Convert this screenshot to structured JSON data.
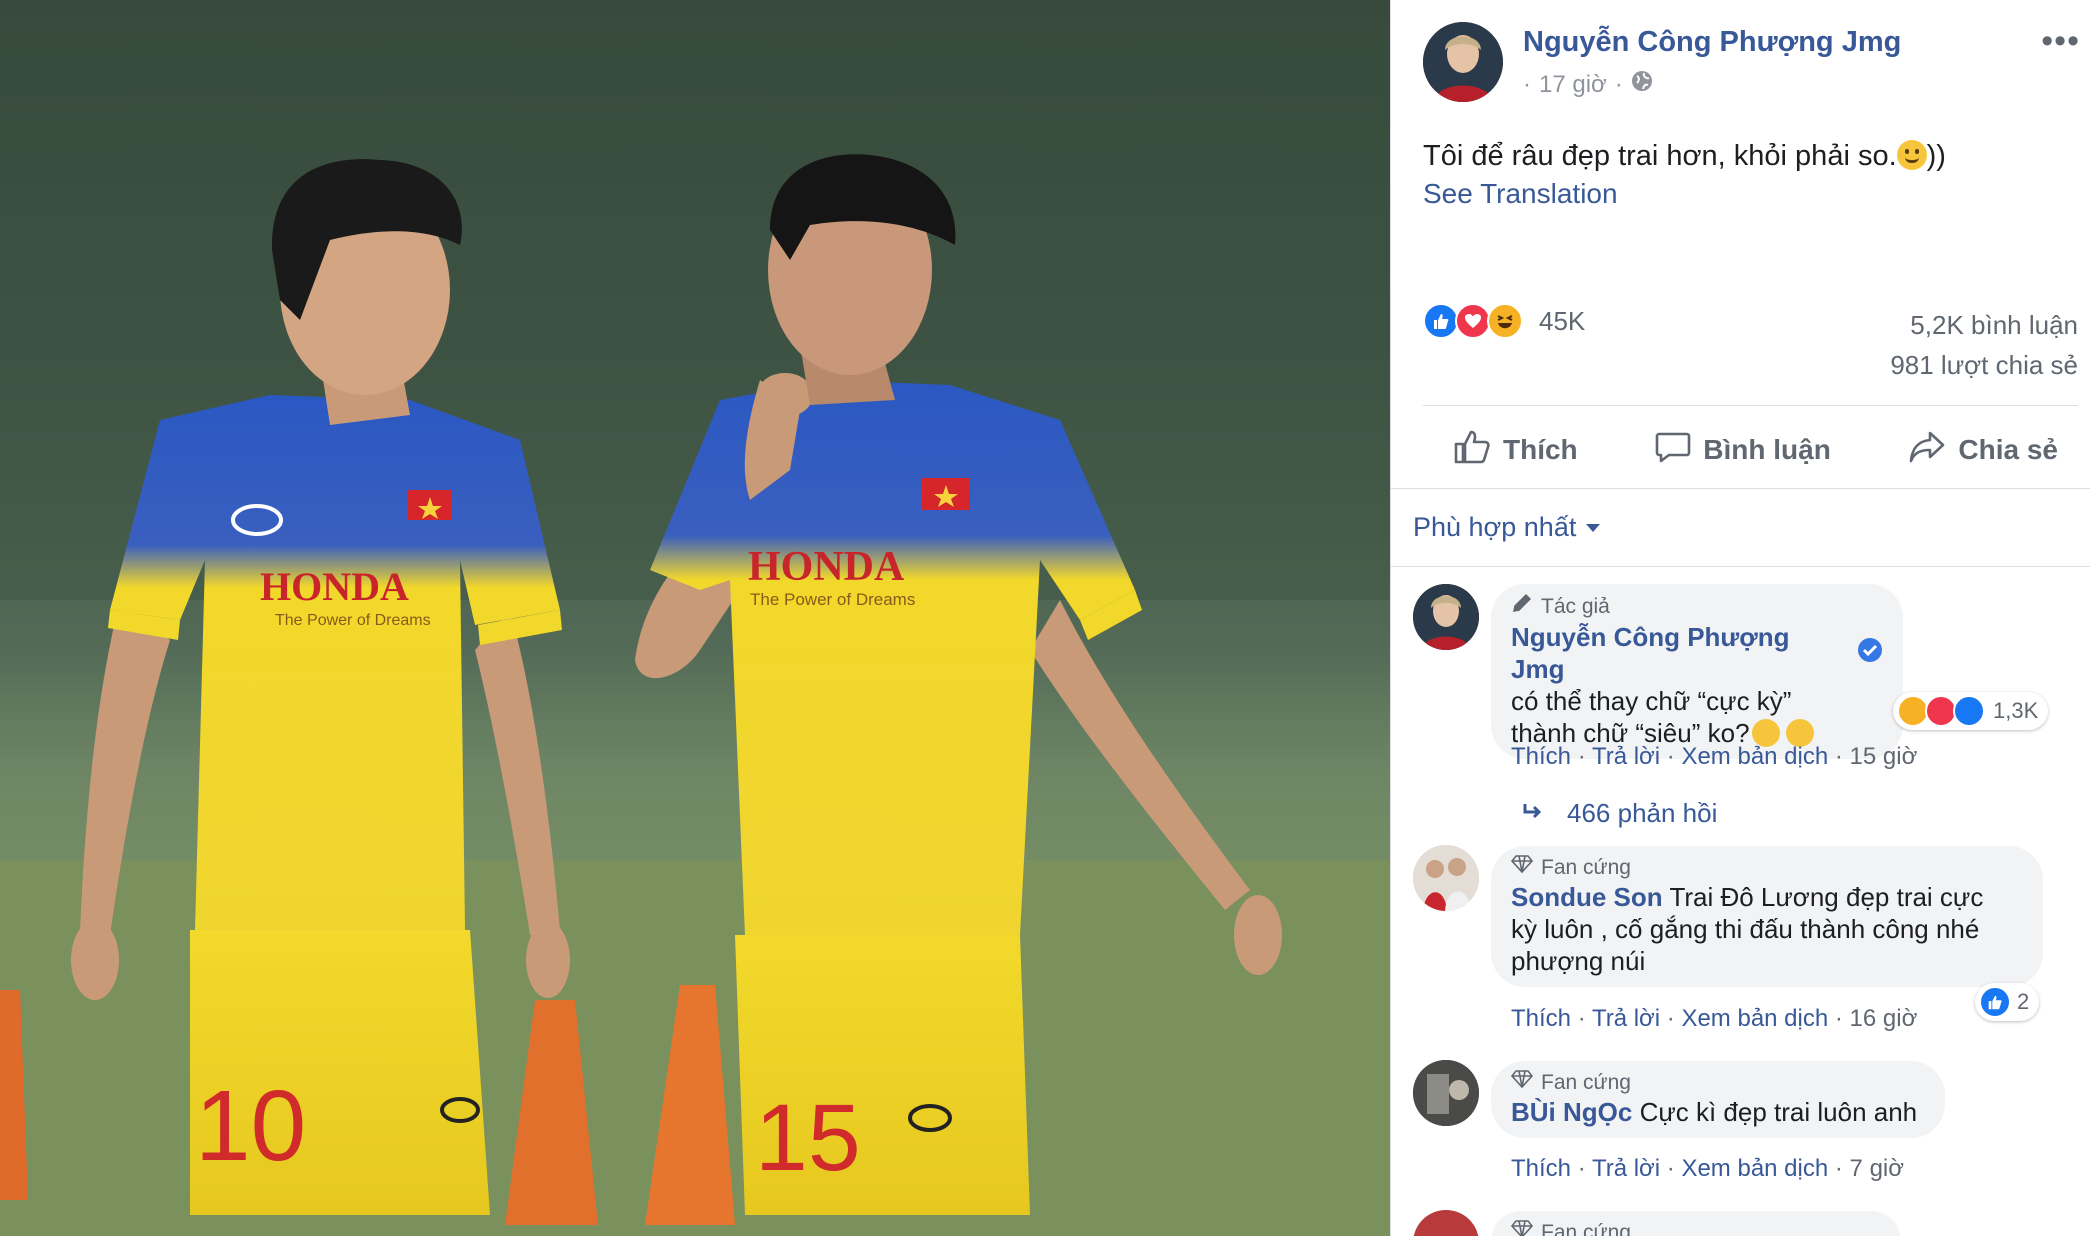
{
  "post": {
    "author": "Nguyễn Công Phượng Jmg",
    "time": "17 giờ",
    "time_prefix": "·",
    "time_sep": "·",
    "text": "Tôi để râu đẹp trai hơn, khỏi phải so.",
    "text_suffix": "))",
    "see_translation": "See Translation",
    "reactions": {
      "count": "45K",
      "types": [
        "like-icon",
        "love-icon",
        "haha-icon"
      ]
    },
    "comments": "5,2K bình luận",
    "shares": "981 lượt chia sẻ"
  },
  "actions": {
    "like": "Thích",
    "comment": "Bình luận",
    "share": "Chia sẻ"
  },
  "sort": {
    "label": "Phù hợp nhất"
  },
  "comments": [
    {
      "badge": "Tác giả",
      "name": "Nguyễn Công Phượng Jmg",
      "line1": "có thể thay chữ “cực kỳ”",
      "line2": "thành chữ “siêu” ko?",
      "reaction_count": "1,3K",
      "like": "Thích",
      "reply": "Trả lời",
      "translate": "Xem bản dịch",
      "time": "15 giờ"
    },
    {
      "badge": "Fan cứng",
      "name": "Sondue Son",
      "text_start": "Trai Đô Lương đẹp trai cực",
      "line2": "kỳ luôn , cố gắng thi đấu thành công nhé",
      "line3": "phượng núi",
      "reaction_count": "2",
      "like": "Thích",
      "reply": "Trả lời",
      "translate": "Xem bản dịch",
      "time": "16 giờ"
    },
    {
      "badge": "Fan cứng",
      "name": "BÙi NgỌc",
      "text_start": "Cực kì đẹp trai luôn anh",
      "like": "Thích",
      "reply": "Trả lời",
      "translate": "Xem bản dịch",
      "time": "7 giờ"
    },
    {
      "badge": "Fan cứng"
    }
  ],
  "replies": {
    "label": "466 phản hồi"
  },
  "photo": {
    "player_left": {
      "jersey_text": "HONDA",
      "slogan": "The Power of Dreams",
      "number": "10"
    },
    "player_right": {
      "jersey_text": "HONDA",
      "slogan": "The Power of Dreams",
      "number": "15"
    }
  },
  "colors": {
    "link": "#385898",
    "jersey": "#f2d82a",
    "sleeve": "#2e55b8",
    "text_muted": "#606770"
  }
}
